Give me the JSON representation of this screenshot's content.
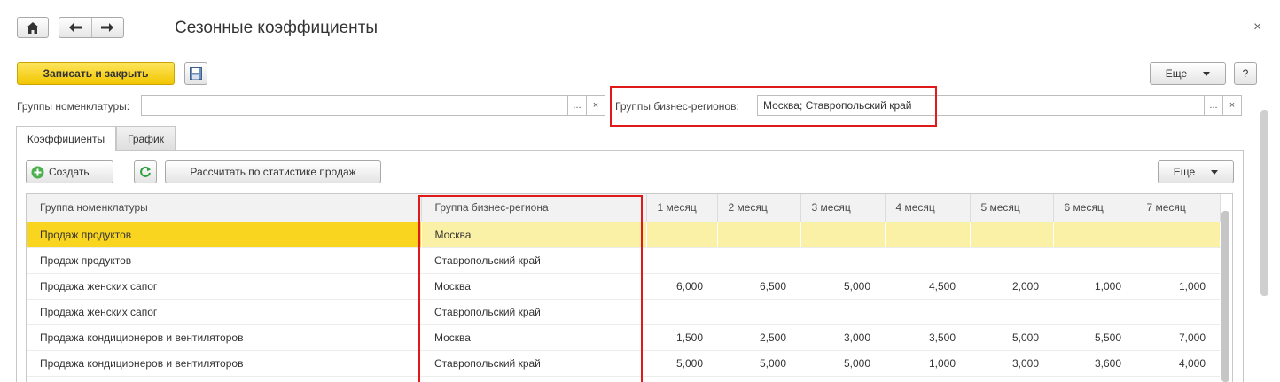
{
  "window": {
    "title": "Сезонные коэффициенты",
    "close": "×"
  },
  "toolbar": {
    "save_close": "Записать и закрыть",
    "more": "Еще",
    "help": "?"
  },
  "filters": {
    "nomenclature_label": "Группы номенклатуры:",
    "nomenclature_value": "",
    "regions_label": "Группы бизнес-регионов:",
    "regions_value": "Москва; Ставропольский край",
    "select_btn": "...",
    "clear_btn": "×"
  },
  "tabs": [
    {
      "label": "Коэффициенты",
      "active": true
    },
    {
      "label": "График",
      "active": false
    }
  ],
  "panel_toolbar": {
    "create": "Создать",
    "calc": "Рассчитать по статистике продаж",
    "more": "Еще"
  },
  "table": {
    "columns": [
      "Группа номенклатуры",
      "Группа бизнес-региона",
      "1 месяц",
      "2 месяц",
      "3 месяц",
      "4 месяц",
      "5 месяц",
      "6 месяц",
      "7 месяц"
    ],
    "rows": [
      [
        "Продаж продуктов",
        "Москва",
        "",
        "",
        "",
        "",
        "",
        "",
        ""
      ],
      [
        "Продаж продуктов",
        "Ставропольский край",
        "",
        "",
        "",
        "",
        "",
        "",
        ""
      ],
      [
        "Продажа женских сапог",
        "Москва",
        "6,000",
        "6,500",
        "5,000",
        "4,500",
        "2,000",
        "1,000",
        "1,000"
      ],
      [
        "Продажа женских сапог",
        "Ставропольский край",
        "",
        "",
        "",
        "",
        "",
        "",
        ""
      ],
      [
        "Продажа кондиционеров и вентиляторов",
        "Москва",
        "1,500",
        "2,500",
        "3,000",
        "3,500",
        "5,000",
        "5,500",
        "7,000"
      ],
      [
        "Продажа кондиционеров и вентиляторов",
        "Ставропольский край",
        "5,000",
        "5,000",
        "5,000",
        "1,000",
        "3,000",
        "3,600",
        "4,000"
      ]
    ],
    "selected_row": 0
  },
  "colors": {
    "accent_yellow": "#f5cc0c",
    "highlight_red": "#e01a1a",
    "selected_row": "#fbf1a6"
  }
}
